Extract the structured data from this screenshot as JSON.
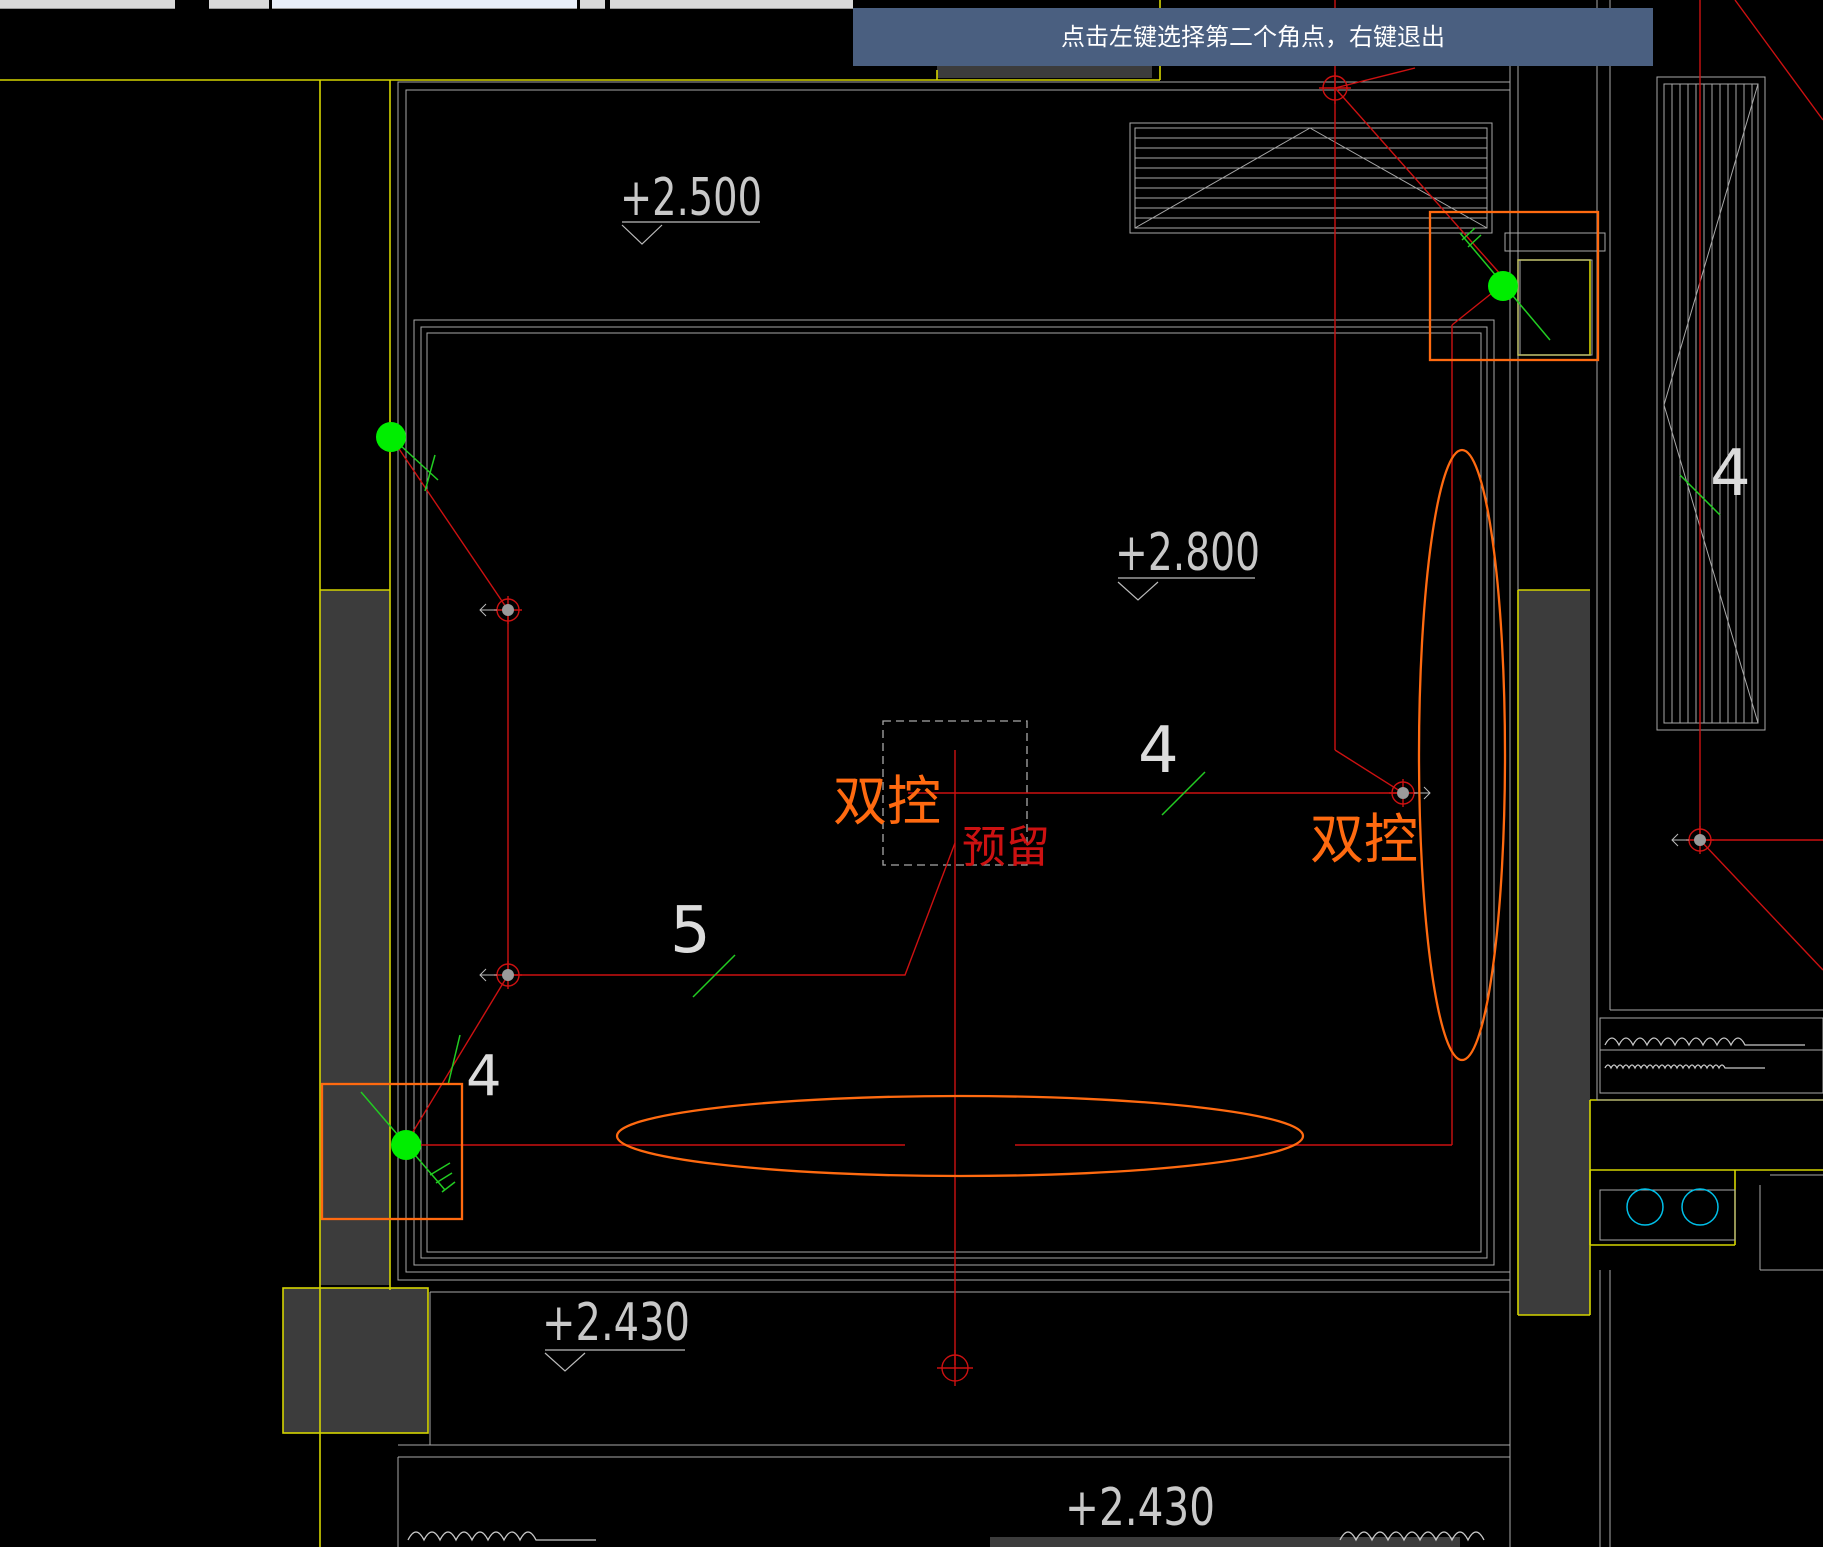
{
  "prompt": {
    "text": "点击左键选择第二个角点，右键退出"
  },
  "colors": {
    "background": "#000000",
    "wall_yellow": "#d4d400",
    "wall_gray": "#a0a0a0",
    "wire_red": "#cc1111",
    "select_orange": "#ff6a10",
    "grip_green": "#00ee00",
    "tick_green": "#22cc22",
    "fill_gray": "#3c3c3c",
    "tooltip_bg": "#4a5f80"
  },
  "elevations": {
    "top_left": "+2.500",
    "center": "+2.800",
    "bottom_left": "+2.430",
    "bottom_center": "+2.430"
  },
  "wire_counts": {
    "upper_right": "4",
    "bottom_left": "4",
    "middle": "4",
    "lower": "5"
  },
  "labels": {
    "dual_control_left": "双控",
    "dual_control_right": "双控",
    "reserved": "预留"
  }
}
